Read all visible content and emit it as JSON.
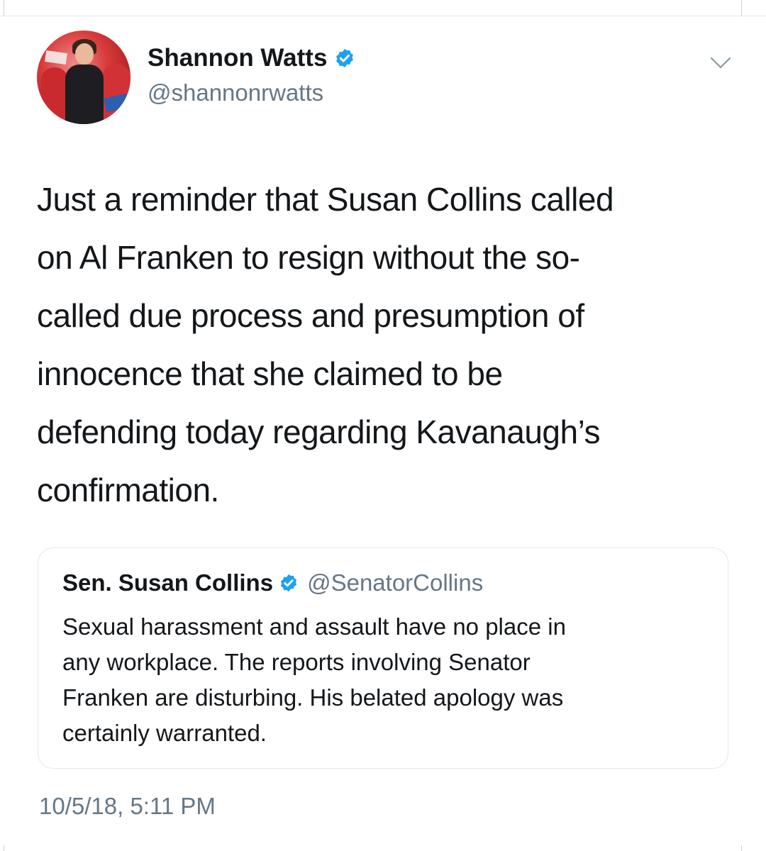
{
  "author": {
    "display_name": "Shannon Watts",
    "handle": "@shannonrwatts",
    "verified": true,
    "verified_color": "#1da1f2"
  },
  "tweet": {
    "text": "Just a reminder that Susan Collins called\non Al Franken to resign without the so-\ncalled due process and presumption of\ninnocence that she claimed to be\ndefending today regarding Kavanaugh’s\nconfirmation.",
    "timestamp": "10/5/18, 5:11 PM"
  },
  "quoted_tweet": {
    "display_name": "Sen. Susan Collins",
    "handle": "@SenatorCollins",
    "verified": true,
    "text": "Sexual harassment and assault have no place in\nany workplace. The reports involving Senator\nFranken are disturbing.  His belated apology was\ncertainly warranted."
  },
  "icons": {
    "avatar": "avatar-photo",
    "verified": "verified-badge-icon",
    "menu": "chevron-down-icon"
  },
  "colors": {
    "text_primary": "#14171a",
    "text_secondary": "#657786",
    "card_border": "#e1e8ed"
  }
}
